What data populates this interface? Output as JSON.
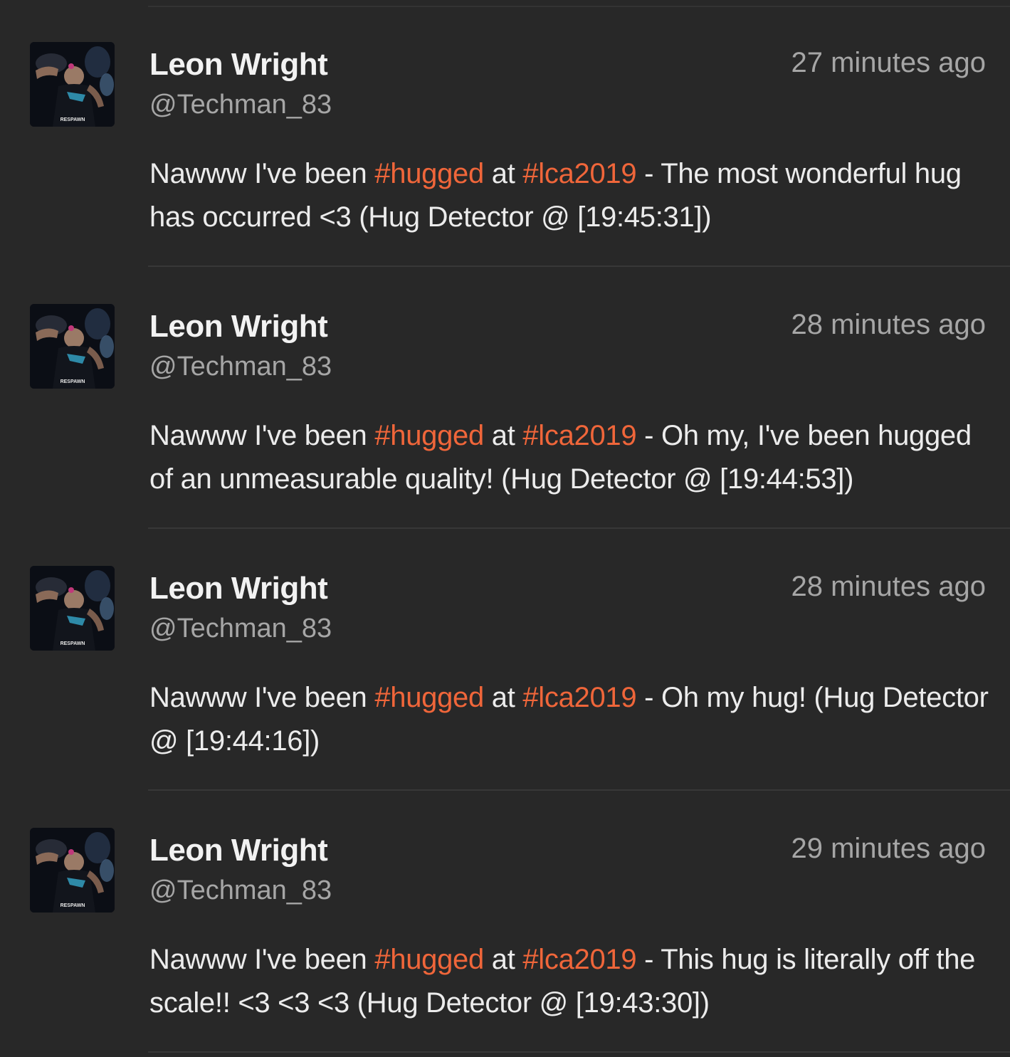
{
  "tweets": [
    {
      "name": "Leon Wright",
      "handle": "@Techman_83",
      "time": "27 minutes ago",
      "text_pre": "Nawww I've been ",
      "tag1": "#hugged",
      "text_mid": " at ",
      "tag2": "#lca2019",
      "text_post": " - The most wonderful hug has occurred <3 (Hug Detector @ [19:45:31])",
      "avatar_caption": "RESPAWN"
    },
    {
      "name": "Leon Wright",
      "handle": "@Techman_83",
      "time": "28 minutes ago",
      "text_pre": "Nawww I've been ",
      "tag1": "#hugged",
      "text_mid": " at ",
      "tag2": "#lca2019",
      "text_post": " - Oh my, I've been hugged of an unmeasurable quality! (Hug Detector @ [19:44:53])",
      "avatar_caption": "RESPAWN"
    },
    {
      "name": "Leon Wright",
      "handle": "@Techman_83",
      "time": "28 minutes ago",
      "text_pre": "Nawww I've been ",
      "tag1": "#hugged",
      "text_mid": " at ",
      "tag2": "#lca2019",
      "text_post": " - Oh my hug! (Hug Detector @ [19:44:16])",
      "avatar_caption": "RESPAWN"
    },
    {
      "name": "Leon Wright",
      "handle": "@Techman_83",
      "time": "29 minutes ago",
      "text_pre": "Nawww I've been ",
      "tag1": "#hugged",
      "text_mid": " at ",
      "tag2": "#lca2019",
      "text_post": " - This hug is literally off the scale!! <3 <3 <3 (Hug Detector @ [19:43:30])",
      "avatar_caption": "RESPAWN"
    }
  ],
  "colors": {
    "background": "#282828",
    "hashtag": "#f0663a",
    "name": "#f2f2f2",
    "muted": "#a6a6a6",
    "divider": "#383838"
  }
}
